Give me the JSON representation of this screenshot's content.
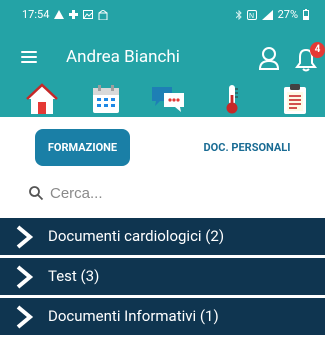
{
  "status_bar": {
    "time": "17:54",
    "battery": "27%"
  },
  "header": {
    "title": "Andrea Bianchi",
    "notification_count": "4",
    "nav_icons": [
      "home-icon",
      "calendar-icon",
      "chat-icon",
      "thermometer-icon",
      "clipboard-icon"
    ]
  },
  "tabs": {
    "active_label": "FORMAZIONE",
    "inactive_label": "DOC. PERSONALI"
  },
  "search": {
    "placeholder": "Cerca..."
  },
  "list": {
    "items": [
      {
        "label": "Documenti cardiologici (2)"
      },
      {
        "label": "Test (3)"
      },
      {
        "label": "Documenti Informativi (1)"
      }
    ]
  },
  "colors": {
    "header_bg": "#24a3a6",
    "active_tab": "#1a7fa6",
    "row_bg": "#0f3550",
    "badge": "#e53935"
  }
}
